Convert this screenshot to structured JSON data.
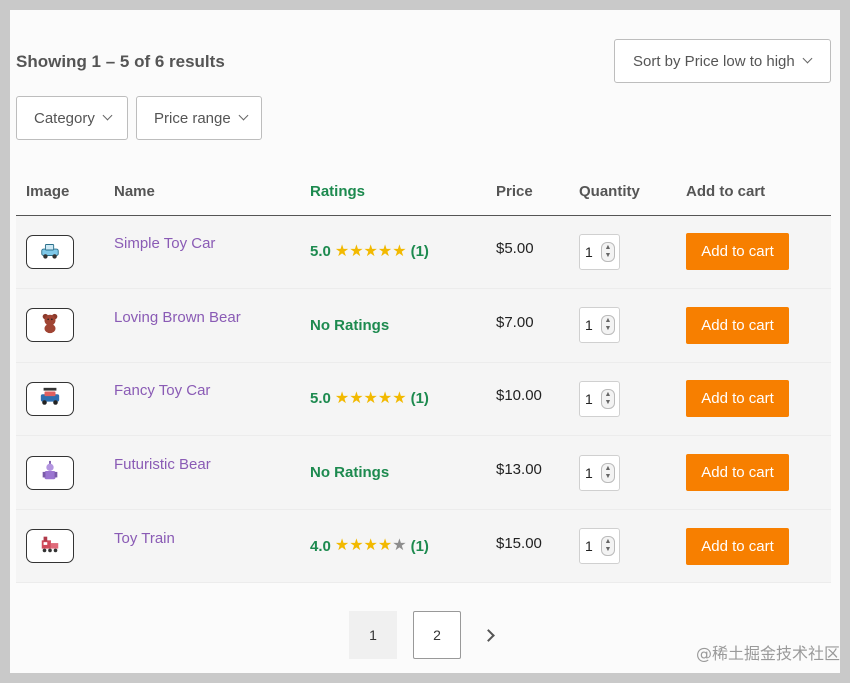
{
  "header": {
    "results_count": "Showing 1 – 5 of 6 results",
    "sort_label": "Sort by Price low to high"
  },
  "filters": {
    "category_label": "Category",
    "price_range_label": "Price range"
  },
  "table": {
    "columns": [
      "Image",
      "Name",
      "Ratings",
      "Price",
      "Quantity",
      "Add to cart"
    ],
    "rows": [
      {
        "icon": "toy-car-icon",
        "name": "Simple Toy Car",
        "rating_text": "5.0",
        "stars": 5,
        "review_count": "(1)",
        "price": "$5.00",
        "quantity": "1",
        "button": "Add to cart"
      },
      {
        "icon": "brown-bear-icon",
        "name": "Loving Brown Bear",
        "rating_text": "No Ratings",
        "stars": 0,
        "review_count": "",
        "price": "$7.00",
        "quantity": "1",
        "button": "Add to cart"
      },
      {
        "icon": "fancy-toy-car-icon",
        "name": "Fancy Toy Car",
        "rating_text": "5.0",
        "stars": 5,
        "review_count": "(1)",
        "price": "$10.00",
        "quantity": "1",
        "button": "Add to cart"
      },
      {
        "icon": "futuristic-bear-icon",
        "name": "Futuristic Bear",
        "rating_text": "No Ratings",
        "stars": 0,
        "review_count": "",
        "price": "$13.00",
        "quantity": "1",
        "button": "Add to cart"
      },
      {
        "icon": "toy-train-icon",
        "name": "Toy Train",
        "rating_text": "4.0",
        "stars": 4,
        "review_count": "(1)",
        "price": "$15.00",
        "quantity": "1",
        "button": "Add to cart"
      }
    ]
  },
  "pagination": {
    "pages": [
      "1",
      "2"
    ],
    "current_page": "1",
    "next_icon": "chevron-right-icon"
  },
  "watermark": "@稀土掘金技术社区",
  "colors": {
    "accent_button": "#f77f00",
    "rating_green": "#1d8a4f",
    "link_purple": "#8a5bb5",
    "star_gold": "#f2b900"
  }
}
